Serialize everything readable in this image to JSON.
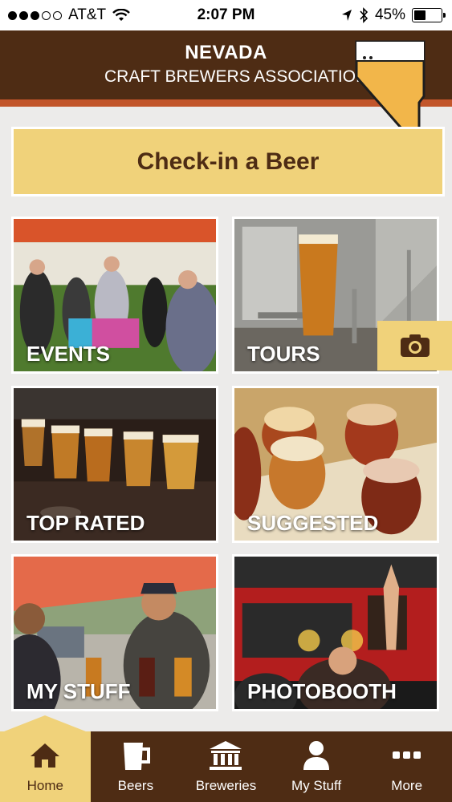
{
  "status_bar": {
    "carrier": "AT&T",
    "time": "2:07 PM",
    "battery": "45%",
    "battery_level": 0.45,
    "signal_bars": 3,
    "signal_total": 5
  },
  "header": {
    "title_line1": "NEVADA",
    "title_line2": "CRAFT BREWERS ASSOCIATION",
    "logo": "nevada-beer-glass-logo"
  },
  "checkin": {
    "label": "Check-in a Beer"
  },
  "tiles": [
    {
      "label": "EVENTS"
    },
    {
      "label": "TOURS"
    },
    {
      "label": "TOP RATED"
    },
    {
      "label": "SUGGESTED"
    },
    {
      "label": "MY STUFF"
    },
    {
      "label": "PHOTOBOOTH"
    }
  ],
  "camera_button": {
    "icon": "camera-icon"
  },
  "tabbar": {
    "items": [
      {
        "label": "Home",
        "icon": "home-icon",
        "active": true
      },
      {
        "label": "Beers",
        "icon": "beer-mug-icon",
        "active": false
      },
      {
        "label": "Breweries",
        "icon": "building-icon",
        "active": false
      },
      {
        "label": "My Stuff",
        "icon": "person-icon",
        "active": false
      },
      {
        "label": "More",
        "icon": "more-dots-icon",
        "active": false
      }
    ]
  },
  "colors": {
    "brand_brown": "#4e2c14",
    "accent_orange": "#c2552a",
    "beer_yellow": "#f0d27a"
  }
}
